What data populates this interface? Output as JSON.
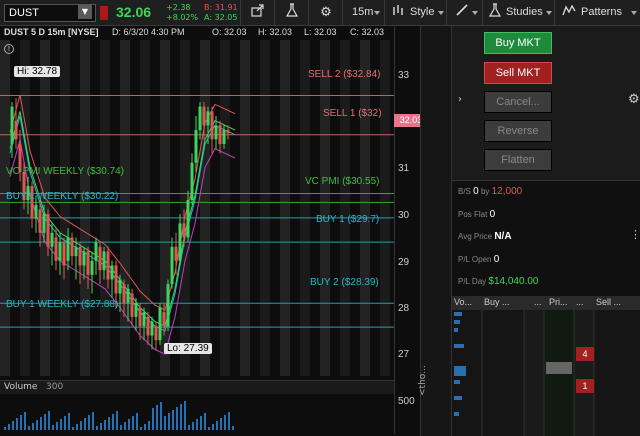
{
  "toolbar": {
    "symbol": "DUST",
    "last_price": "32.06",
    "change": "+2.38",
    "change_pct": "+8.02%",
    "bid": "B: 31.91",
    "ask": "A: 32.05",
    "interval": "15m",
    "style_label": "Style",
    "studies_label": "Studies",
    "patterns_label": "Patterns"
  },
  "chart_header": {
    "title": "DUST 5 D 15m [NYSE]",
    "date": "D: 6/3/20 4:30 PM",
    "open": "O: 32.03",
    "high": "H: 32.03",
    "low": "L: 32.03",
    "close": "C: 32.03"
  },
  "chart_labels": {
    "hi": "Hi: 32.78",
    "lo": "Lo: 27.39",
    "sell2": "SELL 2 ($32.84)",
    "sell1": "SELL 1 ($32)",
    "vc_weekly": "VC PMI WEEKLY ($30.74)",
    "vc_pmi": "VC PMI ($30.55)",
    "buy1_weekly_top": "BUY 1 WEEKLY ($30.22)",
    "buy1": "BUY 1 ($29.7)",
    "buy2": "BUY 2 ($28.39)",
    "buy1_weekly_bottom": "BUY 1 WEEKLY ($27.88)",
    "current_price_tag": "32.03"
  },
  "price_axis": [
    "33",
    "32",
    "31",
    "30",
    "29",
    "28",
    "27"
  ],
  "volume": {
    "label": "Volume",
    "value": "300",
    "axis_500": "500"
  },
  "colors": {
    "sell_line": "#e07070",
    "vc_line": "#3fbf3f",
    "buy_line": "#20b8c8",
    "up_green": "#3ed65a",
    "down_red": "#e05555"
  },
  "right_panel": {
    "buy_mkt": "Buy MKT",
    "sell_mkt": "Sell MKT",
    "cancel": "Cancel...",
    "reverse": "Reverse",
    "flatten": "Flatten",
    "bs_label": "B/S",
    "bs_value": "0",
    "by_label": "by",
    "by_value": "12,000",
    "pos_flat_label": "Pos Flat",
    "pos_flat_value": "0",
    "avg_price_label": "Avg Price",
    "avg_price_value": "N/A",
    "pl_open_label": "P/L Open",
    "pl_open_value": "0",
    "pl_day_label": "P/L Day",
    "pl_day_value": "$14,040.00"
  },
  "ladder": {
    "headers": [
      "Vo...",
      "Buy ...",
      "...",
      "Pri...",
      "...",
      "Sell ..."
    ],
    "sell_cells": [
      "4",
      "1"
    ]
  },
  "mid": {
    "tho_label": "<tho..."
  }
}
